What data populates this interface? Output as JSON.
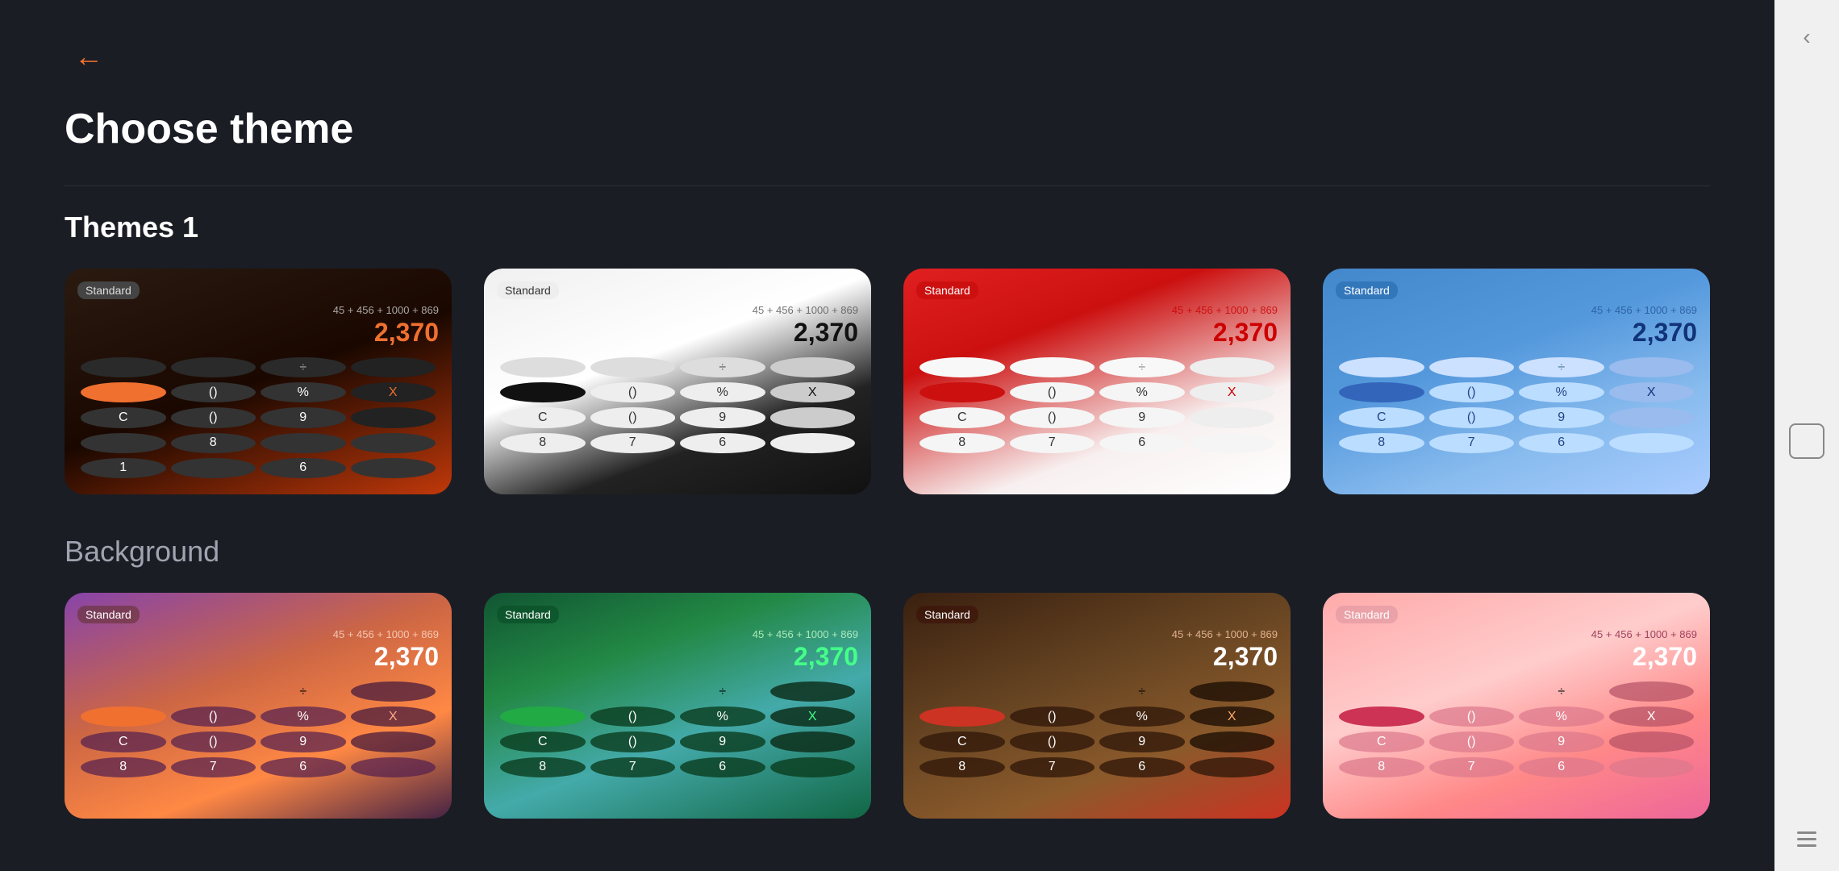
{
  "page": {
    "title": "Choose theme",
    "back_label": "←"
  },
  "sections": [
    {
      "id": "themes1",
      "title": "Themes 1",
      "themes": [
        {
          "id": "dark-orange",
          "style": "dark-orange",
          "bg_class": "theme-dark-orange",
          "mode": "Standard",
          "expression": "45 + 456 + 1000 + 869",
          "result": "2,370"
        },
        {
          "id": "white-black",
          "style": "white-black",
          "bg_class": "theme-white-black",
          "mode": "Standard",
          "expression": "45 + 456 + 1000 + 869",
          "result": "2,370"
        },
        {
          "id": "red-white",
          "style": "red-white",
          "bg_class": "theme-red-white",
          "mode": "Standard",
          "expression": "45 + 456 + 1000 + 869",
          "result": "2,370"
        },
        {
          "id": "blue",
          "style": "blue-theme",
          "bg_class": "theme-blue",
          "mode": "Standard",
          "expression": "45 + 456 + 1000 + 869",
          "result": "2,370"
        }
      ]
    },
    {
      "id": "background",
      "title": "Background",
      "themes": [
        {
          "id": "sunset",
          "style": "sunset-theme",
          "bg_class": "theme-sunset",
          "mode": "Standard",
          "expression": "45 + 456 + 1000 + 869",
          "result": "2,370"
        },
        {
          "id": "green",
          "style": "green-theme",
          "bg_class": "theme-green",
          "mode": "Standard",
          "expression": "45 + 456 + 1000 + 869",
          "result": "2,370"
        },
        {
          "id": "wood",
          "style": "wood-theme",
          "bg_class": "theme-wood",
          "mode": "Standard",
          "expression": "45 + 456 + 1000 + 869",
          "result": "2,370"
        },
        {
          "id": "pink",
          "style": "pink-theme",
          "bg_class": "theme-pink",
          "mode": "Standard",
          "expression": "45 + 456 + 1000 + 869",
          "result": "2,370"
        }
      ]
    }
  ],
  "nav": {
    "chevron": "‹",
    "buttons": [
      "home",
      "menu"
    ]
  }
}
